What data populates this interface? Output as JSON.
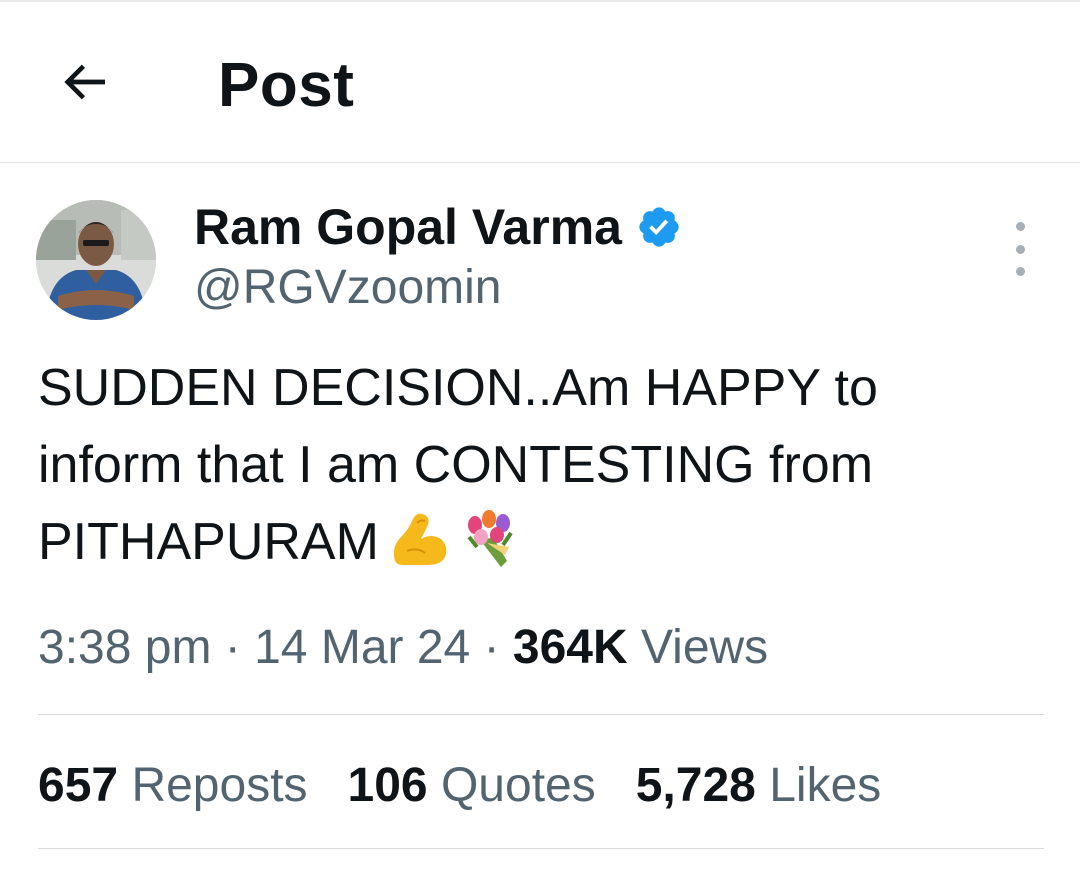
{
  "header": {
    "back_icon": "arrow-left-icon",
    "title": "Post"
  },
  "author": {
    "name": "Ram Gopal Varma",
    "handle": "@RGVzoomin",
    "verified": true,
    "verified_color": "#1d9bf0"
  },
  "post": {
    "lines": [
      "SUDDEN DECISION..Am HAPPY to",
      "inform that I am CONTESTING from",
      "PITHAPURAM"
    ],
    "emojis": [
      "flexed-biceps-icon",
      "bouquet-icon"
    ],
    "time": "3:38 pm",
    "separator": "·",
    "date": "14 Mar 24",
    "views_count": "364K",
    "views_label": "Views"
  },
  "stats": [
    {
      "count": "657",
      "label": "Reposts"
    },
    {
      "count": "106",
      "label": "Quotes"
    },
    {
      "count": "5,728",
      "label": "Likes"
    }
  ],
  "more_icon": "more-vertical-icon"
}
